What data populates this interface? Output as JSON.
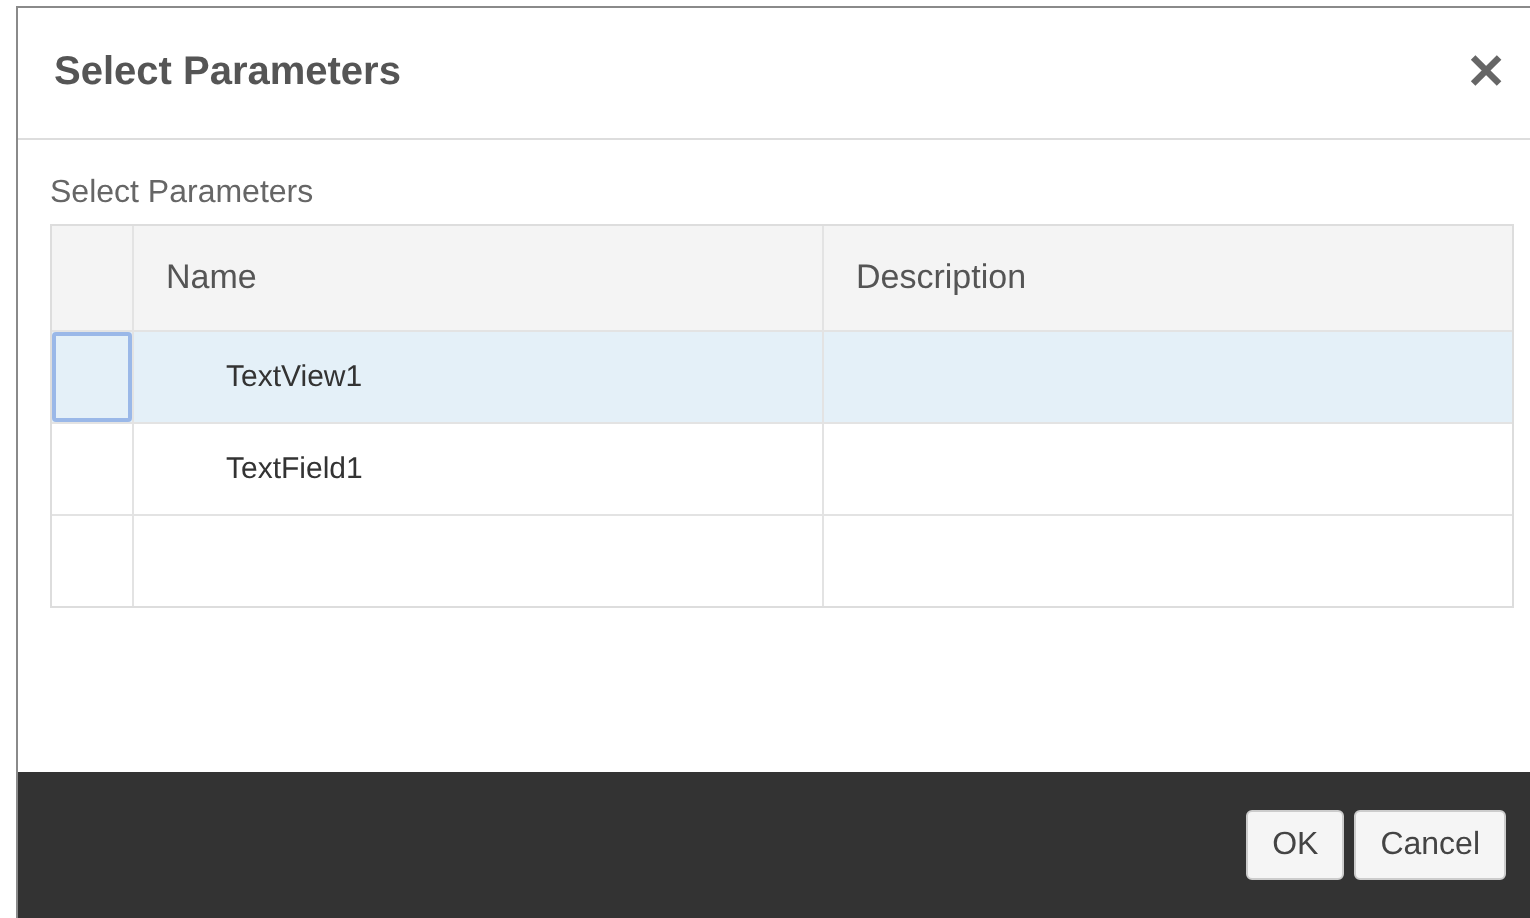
{
  "window": {
    "title": "Select Parameters",
    "close": "✕"
  },
  "section_label": "Select Parameters",
  "table": {
    "columns": [
      "Name",
      "Description"
    ],
    "rows": [
      {
        "name": "TextView1",
        "selected": true
      },
      {
        "name": "TextField1",
        "selected": false
      }
    ]
  },
  "buttons": [
    "OK",
    "Cancel"
  ]
}
